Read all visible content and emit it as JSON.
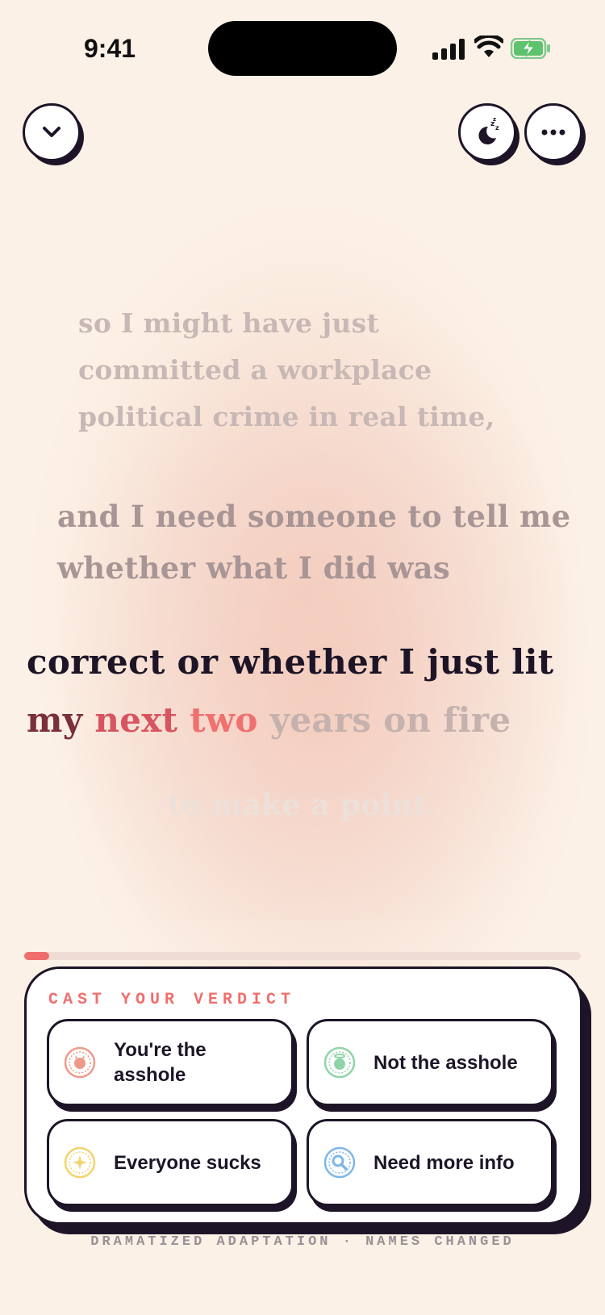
{
  "status_bar": {
    "time": "9:41"
  },
  "header": {
    "collapse_icon": "chevron-down-icon",
    "sleep_icon": "moon-zzz-icon",
    "more_icon": "ellipsis-icon"
  },
  "lyrics": {
    "previous_2": "so I might have just committed a workplace political crime in real time,",
    "previous_1": "and I need someone to tell me whether what I did was",
    "current_line_1": "correct or whether I just lit",
    "current_line_2": {
      "w1": "my",
      "w2": "next",
      "w3": "two",
      "rest": "years on fire"
    },
    "next": "to make a point."
  },
  "progress": {
    "fraction": 0.045
  },
  "verdict": {
    "title": "CAST YOUR VERDICT",
    "options": [
      {
        "label": "You're the asshole",
        "icon": "devil-face-icon",
        "color": "#ee9a8a"
      },
      {
        "label": "Not the asshole",
        "icon": "angel-face-icon",
        "color": "#8fd4a7"
      },
      {
        "label": "Everyone sucks",
        "icon": "sparkle-icon",
        "color": "#f2d36b"
      },
      {
        "label": "Need more info",
        "icon": "magnifier-icon",
        "color": "#7fb6e8"
      }
    ]
  },
  "footer": {
    "text": "DRAMATIZED ADAPTATION · NAMES CHANGED"
  },
  "colors": {
    "accent": "#ef6e6c",
    "ink": "#1d1527",
    "background": "#fcf1e6"
  }
}
